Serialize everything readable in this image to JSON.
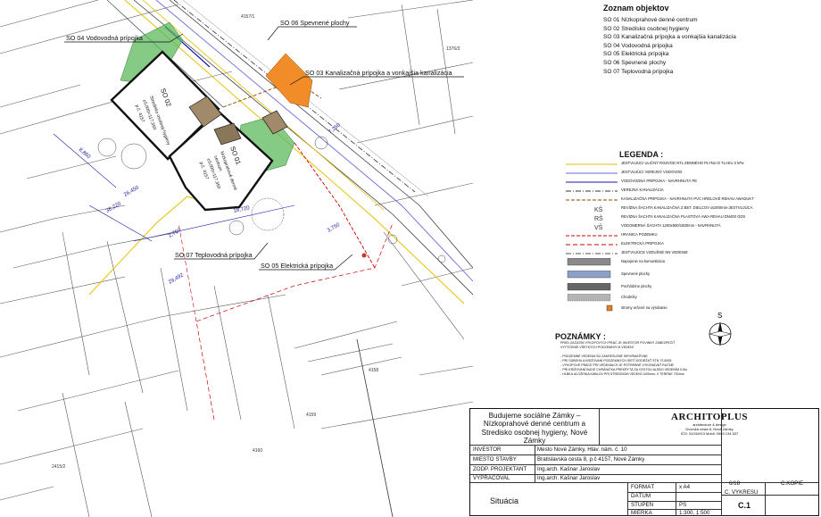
{
  "plan": {
    "objects": [
      {
        "code": "SO 02",
        "line1": "Stredisko osobnej hygieny",
        "line2": "±0,000=117,350",
        "line3": "p.č. 4157"
      },
      {
        "code": "SO 01",
        "line1": "Nízkoprahové denné",
        "line2": "centrum",
        "line3": "±0,000=117,350",
        "line4": "p.č. 4157"
      }
    ],
    "callouts": {
      "vodovod": "SO 04 Vodovodná prípojka",
      "spevnene": "SO 06 Spevnené plochy",
      "kanal": "SO 03 Kanalizačná prípojka a vonkajšia kanalizácia",
      "teplo": "SO 07 Teplovodná prípojka",
      "elektro": "SO 05 Elektrická prípojka"
    },
    "parcels": [
      "4158",
      "4159",
      "4160",
      "2415/2",
      "1376/3",
      "4157/1"
    ],
    "dims": [
      "18,720",
      "8,860",
      "38,220",
      "26,450",
      "29,492",
      "3,750",
      "7,250",
      "2,750"
    ]
  },
  "zoznam": {
    "title": "Zoznam objektov",
    "items": [
      "SO 01 Nízkoprahové denné centrum",
      "SO 02 Stredisko osobnej hygieny",
      "SO 03 Kanalizačná prípojka a vonkajšia kanalizácia",
      "SO 04 Vodovodná prípojka",
      "SO 05 Elektrická prípojka",
      "SO 06 Spevnené plochy",
      "SO 07 Teplovodná prípojka"
    ]
  },
  "legend": {
    "title": "LEGENDA :",
    "items": [
      {
        "label": "JESTVUJÚCI ULIČNÝ ROZVOD NTL ZEMNÉHO PLYNU D TLAKU 2 kPa",
        "color": "#e8c000",
        "style": "solid"
      },
      {
        "label": "JESTVUJÚCI VEREJNÝ VODOVOD",
        "color": "#6a6ad8",
        "style": "solid"
      },
      {
        "label": "VODOVODNÁ PRÍPOJKA - NAVRHNUTÁ PE",
        "color": "#1a1aa0",
        "style": "solid"
      },
      {
        "label": "VEREJNÁ KANALIZÁCIA",
        "color": "#333333",
        "style": "dashdot"
      },
      {
        "label": "KANALIZAČNÁ PRÍPOJKA - NAVRHNUTÁ PVC HRDLOVÉ REHAU AWADUKT",
        "color": "#8a4a00",
        "style": "dash"
      },
      {
        "label": "REVÍZNA ŠACHTA KANALIZAČNÁ Z BET. DIELCOV ø1000mm-JESTVUJÚCA",
        "color": "#333333",
        "style": "sym"
      },
      {
        "label": "REVÍZNA ŠACHTA KANALIZAČNÁ PLASTOVÁ AWA REHAU DN400 GDS",
        "color": "#333333",
        "style": "sym"
      },
      {
        "label": "VODOMERNÁ ŠACHTA 1200x900/1800mm - NAVRHNUTÁ",
        "color": "#333333",
        "style": "sym"
      },
      {
        "label": "HRANICA POZEMKU",
        "color": "#d00000",
        "style": "dash"
      },
      {
        "label": "ELEKTRICKÁ PRÍPOJKA",
        "color": "#d00000",
        "style": "xdash"
      },
      {
        "label": "JESTVUJÚCE VZDUŠNÉ NN VEDENIE",
        "color": "#555555",
        "style": "dashdot"
      },
      {
        "label": "Napojenie na komunikáciu",
        "color": "#8a8a8a",
        "style": "box"
      },
      {
        "label": "Spevnené plochy",
        "color": "#8ea0c8",
        "style": "box"
      },
      {
        "label": "Pochôdzne plochy",
        "color": "#666666",
        "style": "box"
      },
      {
        "label": "Chodníky",
        "color": "#b4b4b4",
        "style": "hatch"
      },
      {
        "label": "stromy určené na výrubanie",
        "color": "#e67e22",
        "style": "dot"
      }
    ],
    "symbols": [
      "KŠ",
      "RŠ",
      "VŠ"
    ]
  },
  "poznamky": {
    "title": "POZNÁMKY :",
    "lines": [
      "PRED ZAČATÍM VÝKOPOVÝCH PRÁC JE INVESTOR POVINNÝ ZABEZPEČIŤ",
      "VYTÝČENIE VŠETKÝCH PODZEMNÝCH VEDENÍ",
      "",
      "- PODZEMNÉ VEDENIA SÚ ZAKRESLENÉ INFORMATÍVNE",
      "- PRI SÚBEHU A KRIŽOVANÍ PODZEMNÝCH SIETÍ DODRŽAŤ STN 73 6005",
      "- VÝKOPOVÉ PRÁCE PRI VEDENIACH JE POTREBNÉ VYKONÁVAŤ RUČNE",
      "- PRI KRIŽOVANÍ BUDE CHRÁNIČKA PREKRYTÁ ZA CESTOU ALEBO VEDENÍM 0,5m",
      "- HĹBKA ULOŽENIA KÁBLOV PRI STREDNOM VEDENÍ 1000mm, V TERÉNE 700mm"
    ]
  },
  "compass": {
    "label": "S"
  },
  "titleblock": {
    "project": "Budujeme sociálne Zámky – Nízkoprahové denné centrum a Stredisko osobnej hygieny, Nové Zámky",
    "firm_logo": "ARCHITOPLUS",
    "firm_sub1": "architecture & design",
    "firm_sub2": "Dvorská cesta 8, Nové Zámky",
    "firm_sub3": "IČO: 51034913 Mobil: 0903 134 637",
    "rows": [
      {
        "label": "INVESTOR",
        "value": "Mesto Nové Zámky, Hlav. nám. č. 10"
      },
      {
        "label": "MIESTO STAVBY",
        "value": "Bratislavská cesta 8, p.č 4157, Nové Zámky"
      },
      {
        "label": "ZODP. PROJEKTANT",
        "value": "Ing.arch. Kašnar Jaroslav"
      },
      {
        "label": "VYPRACOVAL",
        "value": "Ing.arch. Kašnar Jaroslav"
      }
    ],
    "format_label": "FORMÁT",
    "format_value": "x A4",
    "datum_label": "DÁTUM",
    "datum_value": "",
    "stupen_label": "STUPEŇ",
    "stupen_value": "PS",
    "mierka_label": "MIERKA",
    "mierka_value": "1:300, 1:500",
    "kopie_label": "Č.KÓPIE",
    "sheet_value": "6/18",
    "vykres_label": "Č. VÝKRESU",
    "vykres_value": "C.1",
    "drawing_title": "Situácia"
  }
}
